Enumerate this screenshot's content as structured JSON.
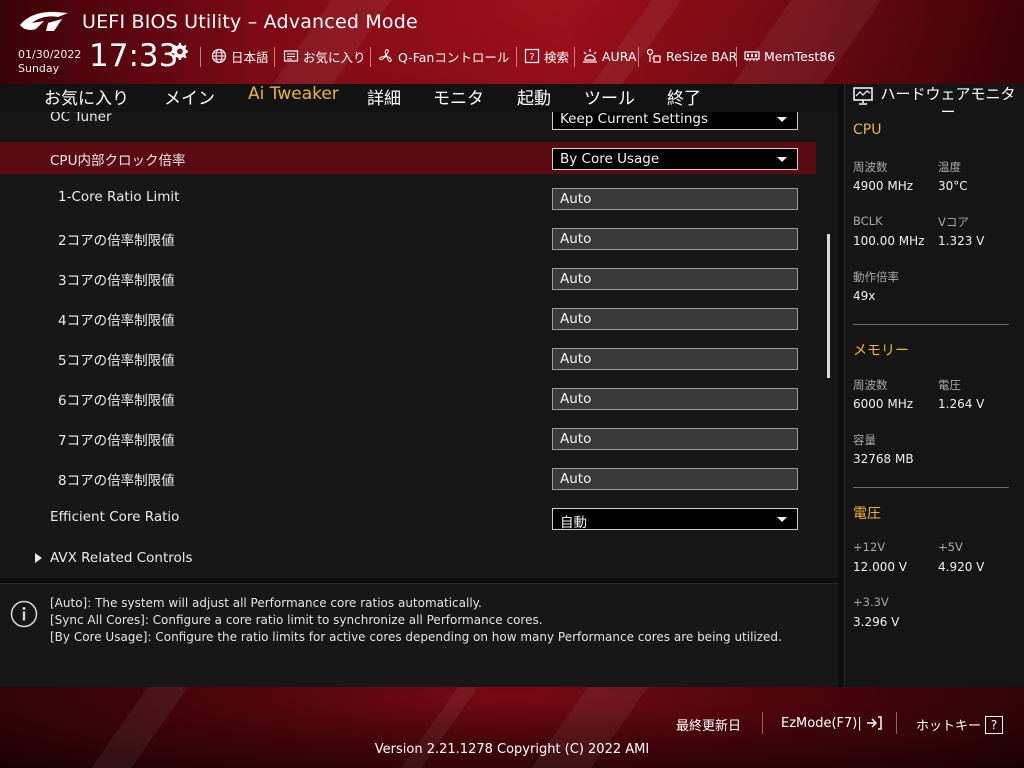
{
  "header": {
    "title": "UEFI BIOS Utility – Advanced Mode",
    "date": "01/30/2022",
    "day": "Sunday",
    "time": "17:33",
    "toolbar": [
      {
        "label": "日本語",
        "icon": "globe-icon"
      },
      {
        "label": "お気に入り",
        "icon": "favorites-icon"
      },
      {
        "label": "Q-Fanコントロール",
        "icon": "fan-icon"
      },
      {
        "label": "検索",
        "icon": "search-help-icon"
      },
      {
        "label": "AURA",
        "icon": "aura-icon"
      },
      {
        "label": "ReSize BAR",
        "icon": "resize-bar-icon"
      },
      {
        "label": "MemTest86",
        "icon": "memtest-icon"
      }
    ]
  },
  "nav": {
    "tabs": [
      {
        "label": "お気に入り",
        "active": false
      },
      {
        "label": "メイン",
        "active": false
      },
      {
        "label": "Ai Tweaker",
        "active": true
      },
      {
        "label": "詳細",
        "active": false
      },
      {
        "label": "モニタ",
        "active": false
      },
      {
        "label": "起動",
        "active": false
      },
      {
        "label": "ツール",
        "active": false
      },
      {
        "label": "終了",
        "active": false
      }
    ]
  },
  "settings": {
    "rows": [
      {
        "label": "OC Tuner",
        "value": "Keep Current Settings",
        "type": "dropdown"
      },
      {
        "label": "CPU内部クロック倍率",
        "value": "By Core Usage",
        "type": "dropdown",
        "selected": true
      },
      {
        "label": "1-Core Ratio Limit",
        "value": "Auto",
        "type": "text",
        "indent": true
      },
      {
        "label": "2コアの倍率制限値",
        "value": "Auto",
        "type": "text",
        "indent": true
      },
      {
        "label": "3コアの倍率制限値",
        "value": "Auto",
        "type": "text",
        "indent": true
      },
      {
        "label": "4コアの倍率制限値",
        "value": "Auto",
        "type": "text",
        "indent": true
      },
      {
        "label": "5コアの倍率制限値",
        "value": "Auto",
        "type": "text",
        "indent": true
      },
      {
        "label": "6コアの倍率制限値",
        "value": "Auto",
        "type": "text",
        "indent": true
      },
      {
        "label": "7コアの倍率制限値",
        "value": "Auto",
        "type": "text",
        "indent": true
      },
      {
        "label": "8コアの倍率制限値",
        "value": "Auto",
        "type": "text",
        "indent": true
      },
      {
        "label": "Efficient Core Ratio",
        "value": "自動",
        "type": "dropdown"
      },
      {
        "label": "AVX Related Controls",
        "type": "submenu"
      }
    ]
  },
  "info": {
    "lines": [
      "[Auto]: The system will adjust all Performance core ratios automatically.",
      "[Sync All Cores]: Configure a core ratio limit to synchronize all Performance cores.",
      "[By Core Usage]: Configure the ratio limits for active cores depending on how many Performance cores are being utilized."
    ]
  },
  "monitor": {
    "title": "ハードウェアモニター",
    "cpu": {
      "heading": "CPU",
      "freq_label": "周波数",
      "freq_value": "4900 MHz",
      "temp_label": "温度",
      "temp_value": "30°C",
      "bclk_label": "BCLK",
      "bclk_value": "100.00 MHz",
      "vcore_label": "Vコア",
      "vcore_value": "1.323 V",
      "ratio_label": "動作倍率",
      "ratio_value": "49x"
    },
    "memory": {
      "heading": "メモリー",
      "freq_label": "周波数",
      "freq_value": "6000 MHz",
      "volt_label": "電圧",
      "volt_value": "1.264 V",
      "cap_label": "容量",
      "cap_value": "32768 MB"
    },
    "voltage": {
      "heading": "電圧",
      "v12_label": "+12V",
      "v12_value": "12.000 V",
      "v5_label": "+5V",
      "v5_value": "4.920 V",
      "v33_label": "+3.3V",
      "v33_value": "3.296 V"
    }
  },
  "footer": {
    "last_modified": "最終更新日",
    "ezmode": "EzMode(F7)|",
    "hotkeys": "ホットキー",
    "hotkey_symbol": "?",
    "version": "Version 2.21.1278 Copyright (C) 2022 AMI"
  },
  "colors": {
    "accent": "#f0b43c",
    "selected_row": "#5a0a10",
    "header_red": "#a3101c"
  }
}
